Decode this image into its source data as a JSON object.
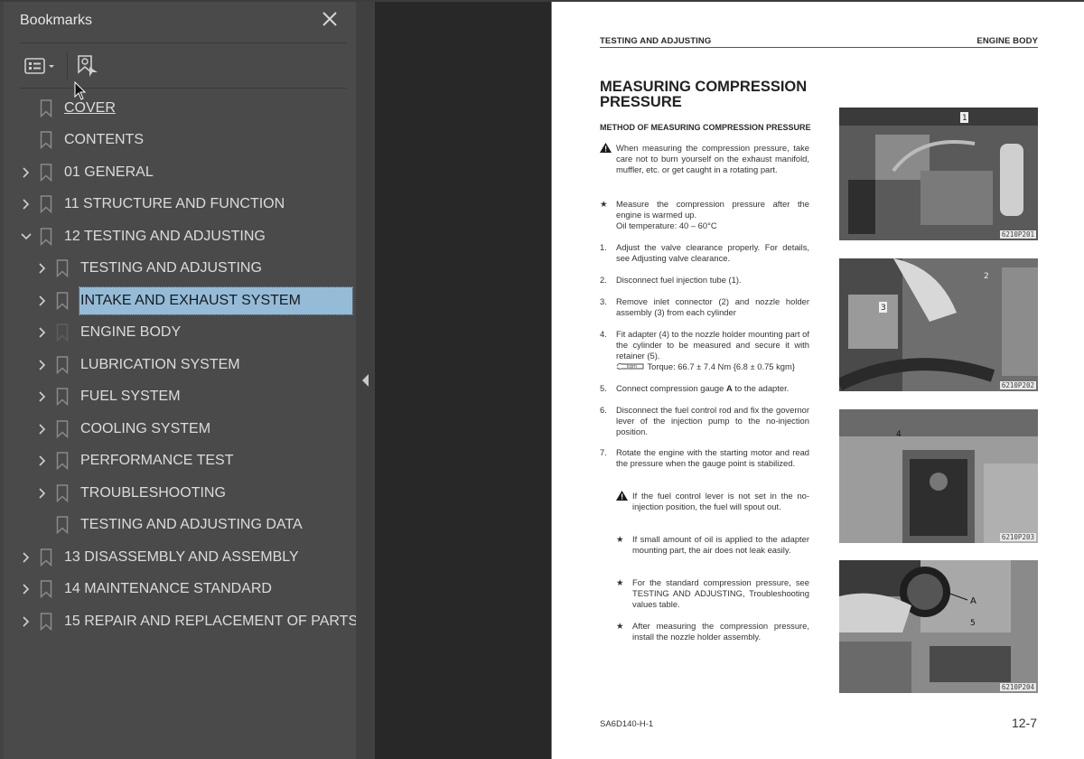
{
  "sidebar": {
    "title": "Bookmarks",
    "close_icon": "close-icon",
    "toolbar": {
      "options_icon": "bookmark-options-icon",
      "find_current_icon": "find-current-bookmark-icon"
    },
    "items": [
      {
        "label": "COVER",
        "level": 0,
        "expander": "none",
        "link": true
      },
      {
        "label": "CONTENTS",
        "level": 0,
        "expander": "none"
      },
      {
        "label": "01 GENERAL",
        "level": 0,
        "expander": "collapsed"
      },
      {
        "label": "11 STRUCTURE AND FUNCTION",
        "level": 0,
        "expander": "collapsed"
      },
      {
        "label": "12 TESTING AND ADJUSTING",
        "level": 0,
        "expander": "expanded"
      },
      {
        "label": "TESTING AND ADJUSTING",
        "level": 1,
        "expander": "collapsed"
      },
      {
        "label": "INTAKE AND EXHAUST SYSTEM",
        "level": 1,
        "expander": "collapsed",
        "selected": true
      },
      {
        "label": "ENGINE BODY",
        "level": 1,
        "expander": "collapsed",
        "dim_icon": true
      },
      {
        "label": "LUBRICATION SYSTEM",
        "level": 1,
        "expander": "collapsed"
      },
      {
        "label": "FUEL SYSTEM",
        "level": 1,
        "expander": "collapsed"
      },
      {
        "label": "COOLING SYSTEM",
        "level": 1,
        "expander": "collapsed"
      },
      {
        "label": "PERFORMANCE TEST",
        "level": 1,
        "expander": "collapsed"
      },
      {
        "label": "TROUBLESHOOTING",
        "level": 1,
        "expander": "collapsed"
      },
      {
        "label": "TESTING AND ADJUSTING DATA",
        "level": 1,
        "expander": "none"
      },
      {
        "label": "13 DISASSEMBLY AND ASSEMBLY",
        "level": 0,
        "expander": "collapsed"
      },
      {
        "label": "14 MAINTENANCE STANDARD",
        "level": 0,
        "expander": "collapsed"
      },
      {
        "label": "15 REPAIR AND REPLACEMENT OF PARTS",
        "level": 0,
        "expander": "collapsed"
      }
    ]
  },
  "splitter": {
    "collapse_icon": "collapse-left-icon"
  },
  "page": {
    "running_head_left": "TESTING AND ADJUSTING",
    "running_head_right": "ENGINE BODY",
    "title_line1": "MEASURING COMPRESSION",
    "title_line2": "PRESSURE",
    "subtitle": "METHOD OF MEASURING COMPRESSION PRESSURE",
    "warning_intro": "When measuring the compression pressure, take care not to burn yourself on the exhaust manifold, muffler, etc. or get caught in a rotating part.",
    "note_warmup": "Measure the compression pressure after the engine is warmed up.",
    "note_oil_temp": "Oil temperature: 40 – 60°C",
    "steps": [
      {
        "num": "1.",
        "text": "Adjust the valve clearance properly. For details, see Adjusting valve clearance."
      },
      {
        "num": "2.",
        "text": "Disconnect fuel injection tube (1)."
      },
      {
        "num": "3.",
        "text": "Remove inlet connector (2) and nozzle holder assembly (3) from each cylinder"
      },
      {
        "num": "4.",
        "text": "Fit adapter (4) to the nozzle holder mounting part of the cylinder to be measured and secure it with retainer (5)."
      },
      {
        "num": "5.",
        "text_pre": "Connect compression gauge ",
        "text_bold": "A",
        "text_post": " to the adapter."
      },
      {
        "num": "6.",
        "text": "Disconnect the fuel control rod and fix the governor lever of the injection pump to the no-injection position."
      },
      {
        "num": "7.",
        "text": "Rotate the engine with the starting motor and read the pressure when the gauge point is stabilized."
      }
    ],
    "torque_label": "kgm",
    "torque": "Torque: 66.7 ± 7.4 Nm {6.8 ± 0.75 kgm}",
    "warning_fuel": "If the fuel control lever is not set in the no-injection position, the fuel will spout out.",
    "notes_after": [
      "If small amount of oil is applied to the adapter mounting part, the air does not leak easily.",
      "For the standard compression pressure, see TESTING AND ADJUSTING, Troubleshooting values table.",
      "After measuring the compression pressure, install the nozzle holder assembly."
    ],
    "photos": [
      {
        "code": "6210P201",
        "callouts": [
          "1"
        ]
      },
      {
        "code": "6210P202",
        "callouts": [
          "2",
          "3"
        ]
      },
      {
        "code": "6210P203",
        "callouts": [
          "4"
        ]
      },
      {
        "code": "6210P204",
        "callouts": [
          "A",
          "5"
        ]
      }
    ],
    "footer_model": "SA6D140-H-1",
    "page_number": "12-7"
  }
}
